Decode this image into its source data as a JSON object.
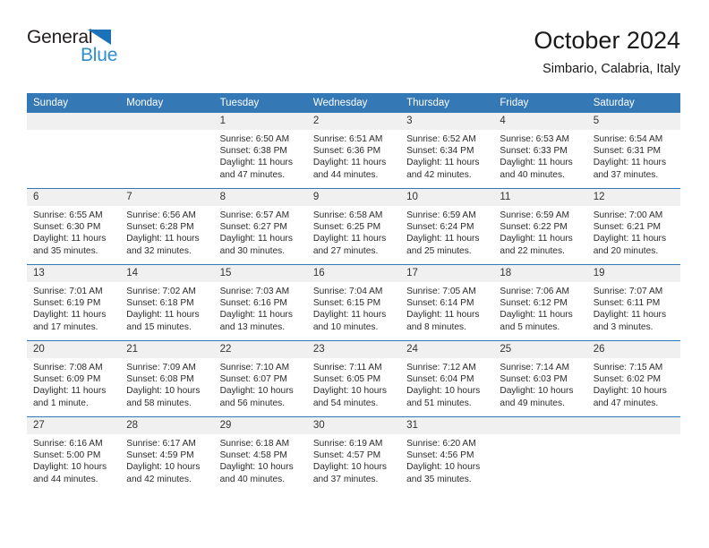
{
  "brand": {
    "name_top": "General",
    "name_bottom": "Blue",
    "triangle_icon": "blue-triangle-logo-mark",
    "color_dark": "#231f20",
    "color_blue": "#2e8ed0"
  },
  "header": {
    "title": "October 2024",
    "subtitle": "Simbario, Calabria, Italy"
  },
  "theme": {
    "header_bg": "#3478b5",
    "daynum_bg": "#f0f0f0",
    "grid_line": "#3478b5"
  },
  "weekday_headers": [
    "Sunday",
    "Monday",
    "Tuesday",
    "Wednesday",
    "Thursday",
    "Friday",
    "Saturday"
  ],
  "weeks": [
    [
      {
        "day": "",
        "empty": true,
        "sunrise": "",
        "sunset": "",
        "daylight_1": "",
        "daylight_2": ""
      },
      {
        "day": "",
        "empty": true,
        "sunrise": "",
        "sunset": "",
        "daylight_1": "",
        "daylight_2": ""
      },
      {
        "day": "1",
        "sunrise": "Sunrise: 6:50 AM",
        "sunset": "Sunset: 6:38 PM",
        "daylight_1": "Daylight: 11 hours",
        "daylight_2": "and 47 minutes."
      },
      {
        "day": "2",
        "sunrise": "Sunrise: 6:51 AM",
        "sunset": "Sunset: 6:36 PM",
        "daylight_1": "Daylight: 11 hours",
        "daylight_2": "and 44 minutes."
      },
      {
        "day": "3",
        "sunrise": "Sunrise: 6:52 AM",
        "sunset": "Sunset: 6:34 PM",
        "daylight_1": "Daylight: 11 hours",
        "daylight_2": "and 42 minutes."
      },
      {
        "day": "4",
        "sunrise": "Sunrise: 6:53 AM",
        "sunset": "Sunset: 6:33 PM",
        "daylight_1": "Daylight: 11 hours",
        "daylight_2": "and 40 minutes."
      },
      {
        "day": "5",
        "sunrise": "Sunrise: 6:54 AM",
        "sunset": "Sunset: 6:31 PM",
        "daylight_1": "Daylight: 11 hours",
        "daylight_2": "and 37 minutes."
      }
    ],
    [
      {
        "day": "6",
        "sunrise": "Sunrise: 6:55 AM",
        "sunset": "Sunset: 6:30 PM",
        "daylight_1": "Daylight: 11 hours",
        "daylight_2": "and 35 minutes."
      },
      {
        "day": "7",
        "sunrise": "Sunrise: 6:56 AM",
        "sunset": "Sunset: 6:28 PM",
        "daylight_1": "Daylight: 11 hours",
        "daylight_2": "and 32 minutes."
      },
      {
        "day": "8",
        "sunrise": "Sunrise: 6:57 AM",
        "sunset": "Sunset: 6:27 PM",
        "daylight_1": "Daylight: 11 hours",
        "daylight_2": "and 30 minutes."
      },
      {
        "day": "9",
        "sunrise": "Sunrise: 6:58 AM",
        "sunset": "Sunset: 6:25 PM",
        "daylight_1": "Daylight: 11 hours",
        "daylight_2": "and 27 minutes."
      },
      {
        "day": "10",
        "sunrise": "Sunrise: 6:59 AM",
        "sunset": "Sunset: 6:24 PM",
        "daylight_1": "Daylight: 11 hours",
        "daylight_2": "and 25 minutes."
      },
      {
        "day": "11",
        "sunrise": "Sunrise: 6:59 AM",
        "sunset": "Sunset: 6:22 PM",
        "daylight_1": "Daylight: 11 hours",
        "daylight_2": "and 22 minutes."
      },
      {
        "day": "12",
        "sunrise": "Sunrise: 7:00 AM",
        "sunset": "Sunset: 6:21 PM",
        "daylight_1": "Daylight: 11 hours",
        "daylight_2": "and 20 minutes."
      }
    ],
    [
      {
        "day": "13",
        "sunrise": "Sunrise: 7:01 AM",
        "sunset": "Sunset: 6:19 PM",
        "daylight_1": "Daylight: 11 hours",
        "daylight_2": "and 17 minutes."
      },
      {
        "day": "14",
        "sunrise": "Sunrise: 7:02 AM",
        "sunset": "Sunset: 6:18 PM",
        "daylight_1": "Daylight: 11 hours",
        "daylight_2": "and 15 minutes."
      },
      {
        "day": "15",
        "sunrise": "Sunrise: 7:03 AM",
        "sunset": "Sunset: 6:16 PM",
        "daylight_1": "Daylight: 11 hours",
        "daylight_2": "and 13 minutes."
      },
      {
        "day": "16",
        "sunrise": "Sunrise: 7:04 AM",
        "sunset": "Sunset: 6:15 PM",
        "daylight_1": "Daylight: 11 hours",
        "daylight_2": "and 10 minutes."
      },
      {
        "day": "17",
        "sunrise": "Sunrise: 7:05 AM",
        "sunset": "Sunset: 6:14 PM",
        "daylight_1": "Daylight: 11 hours",
        "daylight_2": "and 8 minutes."
      },
      {
        "day": "18",
        "sunrise": "Sunrise: 7:06 AM",
        "sunset": "Sunset: 6:12 PM",
        "daylight_1": "Daylight: 11 hours",
        "daylight_2": "and 5 minutes."
      },
      {
        "day": "19",
        "sunrise": "Sunrise: 7:07 AM",
        "sunset": "Sunset: 6:11 PM",
        "daylight_1": "Daylight: 11 hours",
        "daylight_2": "and 3 minutes."
      }
    ],
    [
      {
        "day": "20",
        "sunrise": "Sunrise: 7:08 AM",
        "sunset": "Sunset: 6:09 PM",
        "daylight_1": "Daylight: 11 hours",
        "daylight_2": "and 1 minute."
      },
      {
        "day": "21",
        "sunrise": "Sunrise: 7:09 AM",
        "sunset": "Sunset: 6:08 PM",
        "daylight_1": "Daylight: 10 hours",
        "daylight_2": "and 58 minutes."
      },
      {
        "day": "22",
        "sunrise": "Sunrise: 7:10 AM",
        "sunset": "Sunset: 6:07 PM",
        "daylight_1": "Daylight: 10 hours",
        "daylight_2": "and 56 minutes."
      },
      {
        "day": "23",
        "sunrise": "Sunrise: 7:11 AM",
        "sunset": "Sunset: 6:05 PM",
        "daylight_1": "Daylight: 10 hours",
        "daylight_2": "and 54 minutes."
      },
      {
        "day": "24",
        "sunrise": "Sunrise: 7:12 AM",
        "sunset": "Sunset: 6:04 PM",
        "daylight_1": "Daylight: 10 hours",
        "daylight_2": "and 51 minutes."
      },
      {
        "day": "25",
        "sunrise": "Sunrise: 7:14 AM",
        "sunset": "Sunset: 6:03 PM",
        "daylight_1": "Daylight: 10 hours",
        "daylight_2": "and 49 minutes."
      },
      {
        "day": "26",
        "sunrise": "Sunrise: 7:15 AM",
        "sunset": "Sunset: 6:02 PM",
        "daylight_1": "Daylight: 10 hours",
        "daylight_2": "and 47 minutes."
      }
    ],
    [
      {
        "day": "27",
        "sunrise": "Sunrise: 6:16 AM",
        "sunset": "Sunset: 5:00 PM",
        "daylight_1": "Daylight: 10 hours",
        "daylight_2": "and 44 minutes."
      },
      {
        "day": "28",
        "sunrise": "Sunrise: 6:17 AM",
        "sunset": "Sunset: 4:59 PM",
        "daylight_1": "Daylight: 10 hours",
        "daylight_2": "and 42 minutes."
      },
      {
        "day": "29",
        "sunrise": "Sunrise: 6:18 AM",
        "sunset": "Sunset: 4:58 PM",
        "daylight_1": "Daylight: 10 hours",
        "daylight_2": "and 40 minutes."
      },
      {
        "day": "30",
        "sunrise": "Sunrise: 6:19 AM",
        "sunset": "Sunset: 4:57 PM",
        "daylight_1": "Daylight: 10 hours",
        "daylight_2": "and 37 minutes."
      },
      {
        "day": "31",
        "sunrise": "Sunrise: 6:20 AM",
        "sunset": "Sunset: 4:56 PM",
        "daylight_1": "Daylight: 10 hours",
        "daylight_2": "and 35 minutes."
      },
      {
        "day": "",
        "empty": true,
        "sunrise": "",
        "sunset": "",
        "daylight_1": "",
        "daylight_2": ""
      },
      {
        "day": "",
        "empty": true,
        "sunrise": "",
        "sunset": "",
        "daylight_1": "",
        "daylight_2": ""
      }
    ]
  ]
}
